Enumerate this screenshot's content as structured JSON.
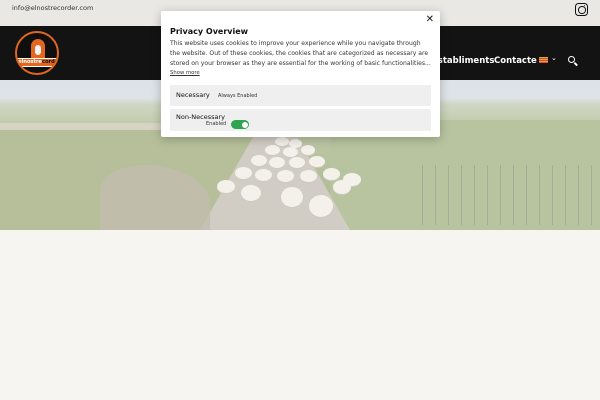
{
  "topbar": {
    "email": "info@elnostrecorder.com",
    "social_icon": "instagram-icon"
  },
  "header": {
    "logo": {
      "part1": "elnostre",
      "part2": "corder",
      "icon": "shepherd-dog-logo"
    },
    "nav": [
      {
        "label": "Establiments"
      },
      {
        "label": "Contacte"
      }
    ],
    "language": {
      "flag": "catalan-flag-icon",
      "dropdown_icon": "chevron-down-icon"
    },
    "search_icon": "search-icon"
  },
  "hero": {
    "image": "flock of sheep walking down a country road between green fields"
  },
  "cookie_modal": {
    "close_icon": "close-icon",
    "title": "Privacy Overview",
    "text": "This website uses cookies to improve your experience while you navigate through the website. Out of these cookies, the cookies that are categorized as necessary are stored on your browser as they are essential for the working of basic functionalities...",
    "show_more": "Show more",
    "categories": [
      {
        "name": "Necessary",
        "status": "Always Enabled"
      },
      {
        "name": "Non-Necessary",
        "status": "Enabled",
        "toggle_on": true
      }
    ]
  },
  "colors": {
    "accent": "#e2661e",
    "header_bg": "#131313",
    "toggle_on": "#2ea44f"
  }
}
